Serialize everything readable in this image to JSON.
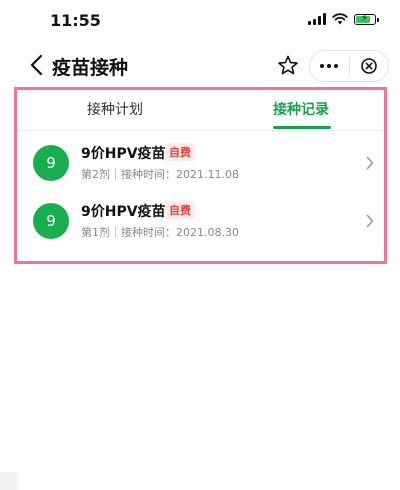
{
  "status_bar": {
    "time": "11:55",
    "battery_level": 0.8
  },
  "nav_bar": {
    "title": "疫苗接种"
  },
  "tabs": [
    {
      "label": "接种计划",
      "active": false
    },
    {
      "label": "接种记录",
      "active": true
    }
  ],
  "records": [
    {
      "dose_number": "9",
      "vaccine": "9价HPV疫苗",
      "badge": "自费",
      "meta": "第2剂｜接种时间：2021.11.08"
    },
    {
      "dose_number": "9",
      "vaccine": "9价HPV疫苗",
      "badge": "自费",
      "meta": "第1剂｜接种时间：2021.08.30"
    }
  ],
  "colors": {
    "accent_green": "#17a34e",
    "avatar_green": "#1aad4f",
    "badge_red": "#e2463c",
    "highlight_pink": "#f07399"
  }
}
